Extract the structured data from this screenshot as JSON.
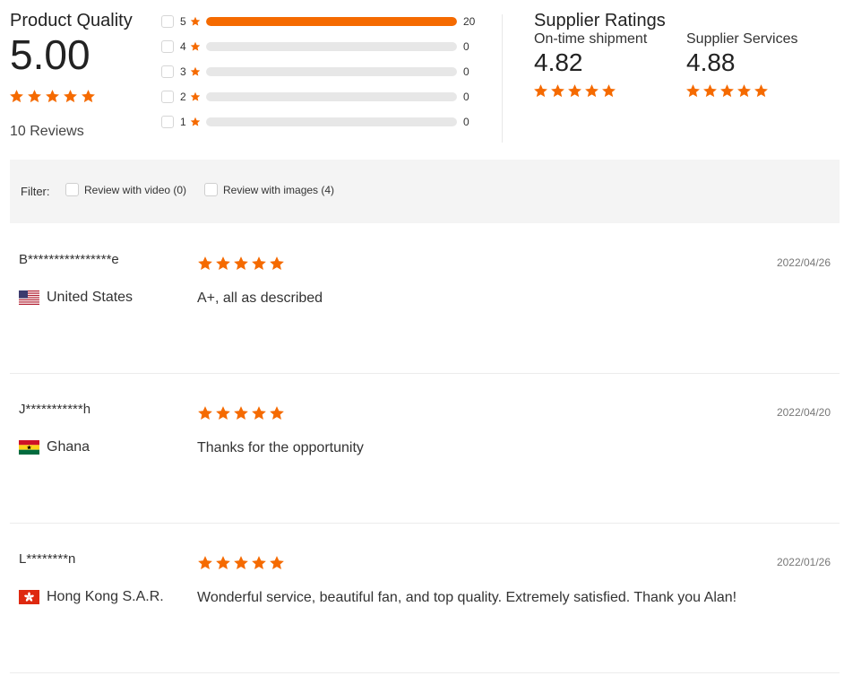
{
  "colors": {
    "accent": "#f56a00",
    "track": "#e7e7e7",
    "filter_bg": "#f4f4f4"
  },
  "product_quality": {
    "title": "Product Quality",
    "score": "5.00",
    "stars": 5,
    "reviews_label": "10 Reviews",
    "breakdown": [
      {
        "level": "5",
        "count": "20",
        "fraction": 1.0
      },
      {
        "level": "4",
        "count": "0",
        "fraction": 0
      },
      {
        "level": "3",
        "count": "0",
        "fraction": 0
      },
      {
        "level": "2",
        "count": "0",
        "fraction": 0
      },
      {
        "level": "1",
        "count": "0",
        "fraction": 0
      }
    ]
  },
  "supplier_ratings": {
    "title": "Supplier Ratings",
    "metrics": [
      {
        "label": "On-time shipment",
        "value": "4.82",
        "stars": 5
      },
      {
        "label": "Supplier Services",
        "value": "4.88",
        "stars": 5
      }
    ]
  },
  "filter": {
    "label": "Filter:",
    "options": [
      {
        "label": "Review with video (0)",
        "checked": false
      },
      {
        "label": "Review with images (4)",
        "checked": false
      }
    ]
  },
  "reviews": [
    {
      "name": "B****************e",
      "country": "United States",
      "flag": "us-flag-icon",
      "stars": 5,
      "text": "A+, all as described",
      "date": "2022/04/26"
    },
    {
      "name": "J***********h",
      "country": "Ghana",
      "flag": "ghana-flag-icon",
      "stars": 5,
      "text": "Thanks for the opportunity",
      "date": "2022/04/20"
    },
    {
      "name": "L********n",
      "country": "Hong Kong S.A.R.",
      "flag": "hong-kong-flag-icon",
      "stars": 5,
      "text": "Wonderful service, beautiful fan, and top quality. Extremely satisfied. Thank you Alan!",
      "date": "2022/01/26"
    }
  ]
}
